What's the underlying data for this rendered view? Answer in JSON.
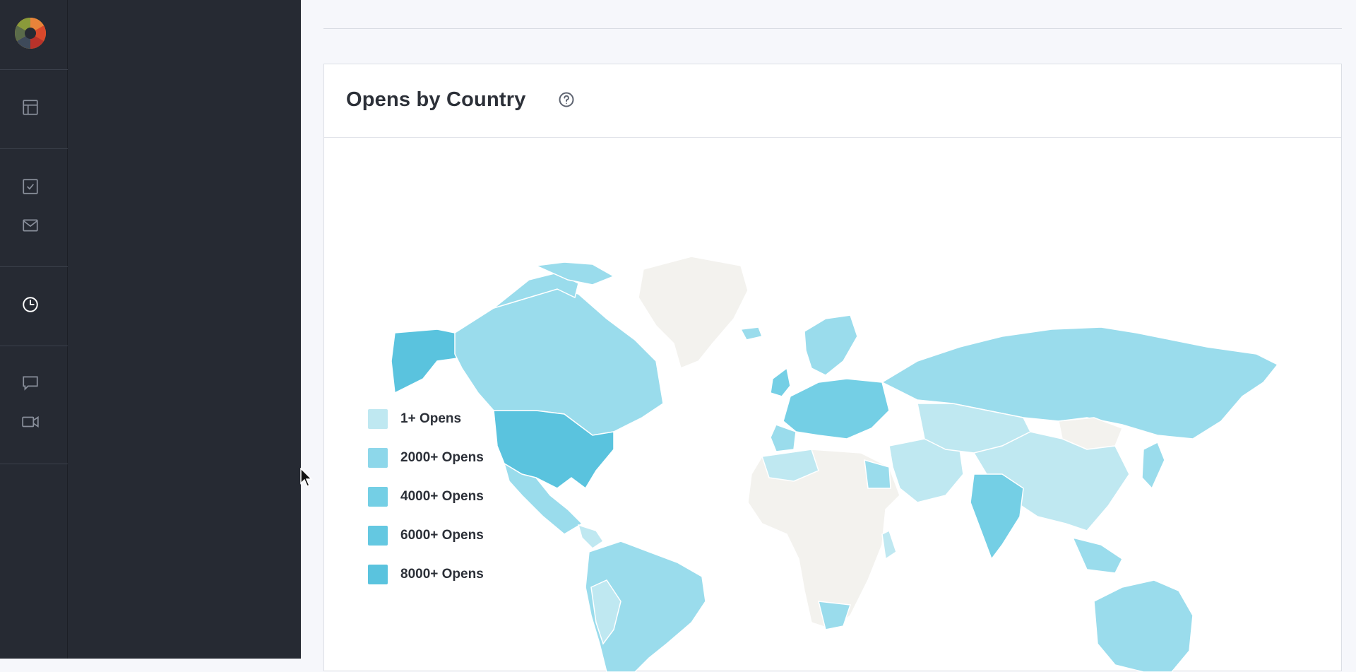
{
  "card": {
    "title": "Opens by Country",
    "help_icon": "help-circle-icon"
  },
  "rail": {
    "logo": "app-logo",
    "items": [
      {
        "icon": "layout-icon"
      },
      {
        "icon": "checkbox-icon"
      },
      {
        "icon": "mail-icon"
      },
      {
        "icon": "reports-clock-icon",
        "active": true
      },
      {
        "icon": "chat-icon"
      },
      {
        "icon": "video-icon"
      }
    ]
  },
  "legend": [
    {
      "label": "1+ Opens",
      "color": "#bfe8f1"
    },
    {
      "label": "2000+ Opens",
      "color": "#8dd7ea"
    },
    {
      "label": "4000+ Opens",
      "color": "#74cfe5"
    },
    {
      "label": "6000+ Opens",
      "color": "#64c8e1"
    },
    {
      "label": "8000+ Opens",
      "color": "#5ac3de"
    }
  ],
  "colors": {
    "no_data": "#f3f2ee",
    "tier1": "#bfe8f1",
    "tier2": "#9adcec",
    "top": "#5ac3de",
    "sidebar": "#262a33",
    "page_bg": "#f6f7fb"
  }
}
